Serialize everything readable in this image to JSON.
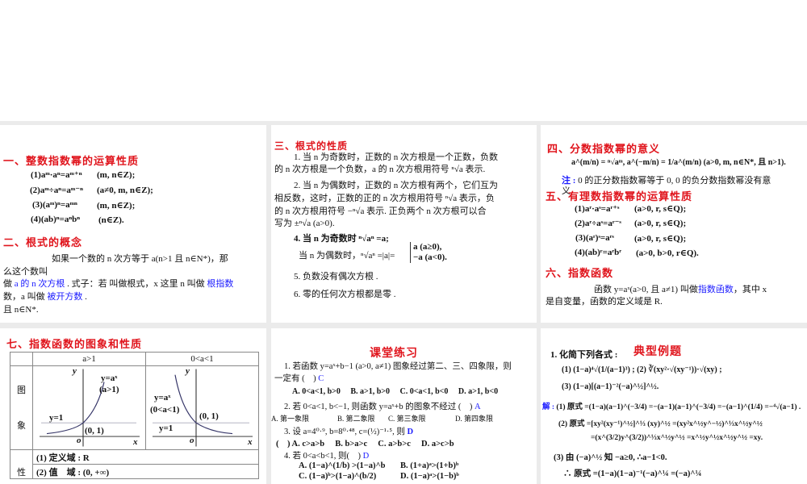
{
  "slide1": {
    "heading1": "一、整数指数幂的运算性质",
    "rules": [
      {
        "f": "(1)aᵐ·aⁿ=aᵐ⁺ⁿ",
        "c": "(m, n∈Z);"
      },
      {
        "f": "(2)aᵐ÷aⁿ=aᵐ⁻ⁿ",
        "c": "(a≠0, m, n∈Z);"
      },
      {
        "f": "(3)(aᵐ)ⁿ=aᵐⁿ",
        "c": "(m, n∈Z);"
      },
      {
        "f": "(4)(ab)ⁿ=aⁿbⁿ",
        "c": "(n∈Z)."
      }
    ],
    "heading2": "二、根式的概念",
    "para_line1": "如果一个数的 n 次方等于 a(n>1 且 n∈N*)，那",
    "para_line2": "么这个数叫",
    "para_line3a": "做",
    "para_line3b": "a 的 n 次方根",
    "para_line3c": ". 式子：若 叫做根式，x 这里 n 叫做",
    "para_line3d": "根指数",
    "para_line4a": "数，a 叫做",
    "para_line4b": "被开方数",
    "para_line4c": ".",
    "para_line5": "且 n∈N*."
  },
  "slide2": {
    "heading": "三、根式的性质",
    "lines": [
      "1. 当 n 为奇数时，正数的 n 次方根是一个正数，负数",
      "的 n 次方根是一个负数，a 的 n 次方根用符号 ⁿ√a 表示.",
      "2. 当 n 为偶数时，正数的 n 次方根有两个，它们互为",
      "相反数，这时，正数的正的 n 次方根用符号 ⁿ√a 表示，负",
      "的 n 次方根用符号 −ⁿ√a 表示. 正负两个 n 次方根可以合",
      "写为 ±ⁿ√a (a>0).",
      "4. 当 n 为奇数时 ⁿ√aⁿ =a;",
      "当 n 为偶数时，ⁿ√aⁿ =|a|=",
      "5. 负数没有偶次方根 .",
      "6. 零的任何次方根都是零 ."
    ],
    "case1": "a  (a≥0),",
    "case2": "−a (a<0)."
  },
  "slide3": {
    "heading4": "四、分数指数幂的意义",
    "formula": "a^(m/n) = ⁿ√aᵐ, a^(−m/n) = 1/a^(m/n) (a>0, m, n∈N*, 且 n>1).",
    "note_label": "注 :",
    "note": "0 的正分数指数幂等于 0, 0 的负分数指数幂没有意",
    "note2": "义",
    "heading5": "五、有理数指数幂的运算性质",
    "rules": [
      {
        "f": "(1)aʳ·aˢ=aʳ⁺ˢ",
        "c": "(a>0, r, s∈Q);"
      },
      {
        "f": "(2)aʳ÷aˢ=aʳ⁻ˢ",
        "c": "(a>0, r, s∈Q);"
      },
      {
        "f": "(3)(aʳ)ˢ=aʳˢ",
        "c": "(a>0, r, s∈Q);"
      },
      {
        "f": "(4)(ab)ʳ=aʳbʳ",
        "c": "(a>0, b>0, r∈Q)."
      }
    ],
    "heading6": "六、指数函数",
    "def_a": "函数 y=aˣ(a>0, 且 a≠1) 叫做",
    "def_b": "指数函数",
    "def_c": "，其中 x",
    "def2": "是自变量，函数的定义域是 R."
  },
  "slide4": {
    "heading": "七、指数函数的图象和性质",
    "col1": "a>1",
    "col2": "0<a<1",
    "row_label_1": "图",
    "row_label_2": "象",
    "g1": {
      "y": "y",
      "x": "x",
      "o": "o",
      "curve": "y=aˣ",
      "cond": "(a>1)",
      "line": "y=1",
      "point": "(0, 1)"
    },
    "g2": {
      "y": "y",
      "x": "x",
      "o": "o",
      "curve": "y=aˣ",
      "cond": "(0<a<1)",
      "line": "y=1",
      "point": "(0, 1)"
    },
    "prop1": "(1) 定义域 : R",
    "prop_label": "性",
    "prop2": "(2) 值　域 : (0, +∞)"
  },
  "slide5": {
    "heading": "课堂练习",
    "q1": "1. 若函数 y=aˣ+b−1 (a>0, a≠1) 图象经过第二、三、四象限，则",
    "q1b": "一定有 (　)",
    "q1ans": "C",
    "q1opts": "A. 0<a<1, b>0　 B. a>1, b>0　 C. 0<a<1, b<0　 D. a>1, b<0",
    "q2": "2. 若 0<a<1, b<−1, 则函数 y=aˣ+b 的图象不经过 (　)",
    "q2ans": "A",
    "q2opts": [
      "A. 第一象限",
      "B. 第二象限",
      "C. 第三象限",
      "D. 第四象限"
    ],
    "q3": "3. 设 a=4⁰·⁹, b=8⁰·⁴⁸, c=(½)⁻¹·⁵, 则",
    "q3ans": "D",
    "q3opts": "(　) A. c>a>b　 B. b>a>c　 C. a>b>c　 D. a>c>b",
    "q4": "4. 若 0<a<b<1, 则(　)",
    "q4ans": "D",
    "q4optsA": "A. (1−a)^(1/b) >(1−a)^b",
    "q4optsB": "B. (1+a)ᵃ>(1+b)ᵇ",
    "q4optsC": "C. (1−a)ᵇ>(1−a)^(b/2)",
    "q4optsD": "D. (1−a)ᵃ>(1−b)ᵇ"
  },
  "slide6": {
    "title_q": "1. 化简下列各式 :",
    "heading": "典型例题",
    "e1": "(1) (1−a)⁴√(1/(a−1)³) ;  (2) ∛(xy²·√(xy⁻¹))·√(xy) ;",
    "e3": "(3) (1−a)[(a−1)⁻²(−a)^½]^½.",
    "sol_label": "解 :",
    "s1": "(1) 原式 =(1−a)(a−1)^(−3/4) =−(a−1)(a−1)^(−3/4) =−(a−1)^(1/4) =−⁴√(a−1) .",
    "s2": "(2) 原式 =[xy²(xy⁻¹)^½]^⅓ (xy)^½ =(xy²x^½y^−½)^⅓x^½y^½",
    "s2b": "=(x^(3/2)y^(3/2))^⅓x^½y^½ =x^½y^½x^½y^½ =xy.",
    "s3": "(3) 由 (−a)^½ 知 −a≥0, ∴a−1<0.",
    "s3b": "∴ 原式 =(1−a)(1−a)⁻¹(−a)^¼ =(−a)^¼"
  }
}
